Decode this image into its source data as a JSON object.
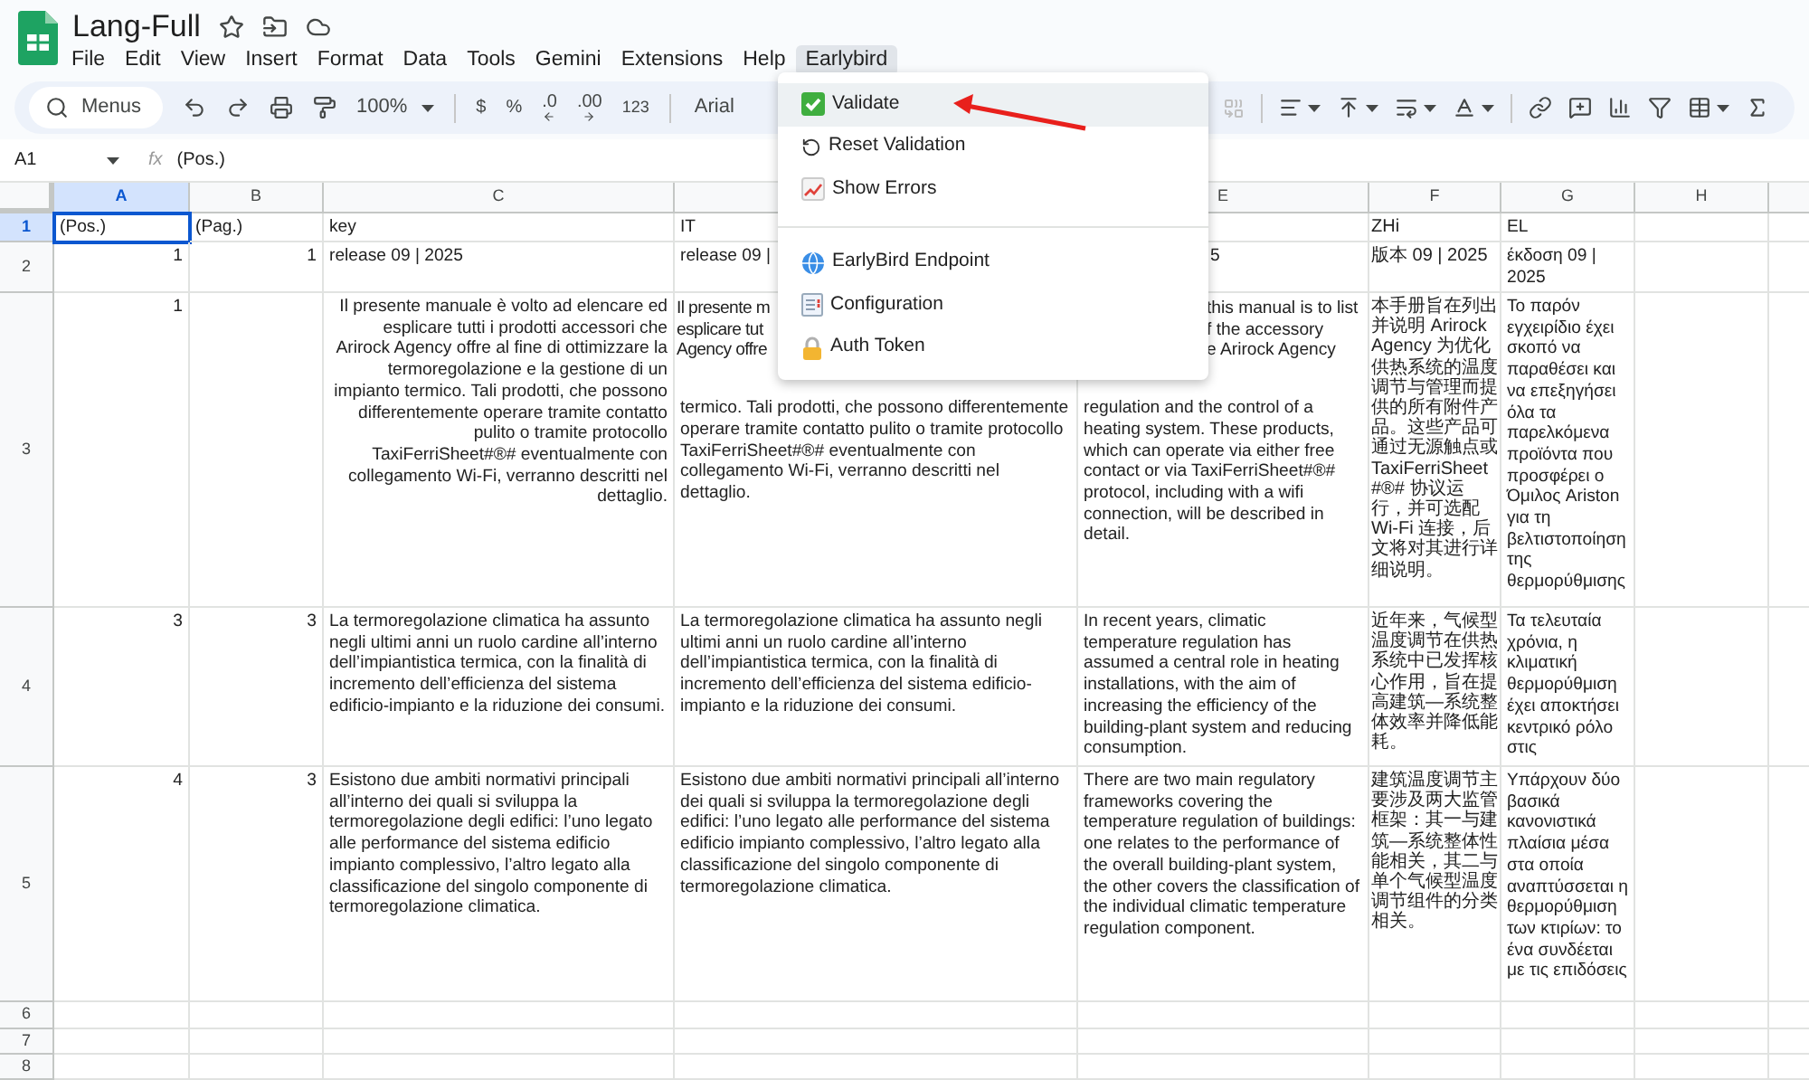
{
  "document": {
    "title": "Lang-Full"
  },
  "menubar": [
    {
      "label": "File",
      "selected": false
    },
    {
      "label": "Edit",
      "selected": false
    },
    {
      "label": "View",
      "selected": false
    },
    {
      "label": "Insert",
      "selected": false
    },
    {
      "label": "Format",
      "selected": false
    },
    {
      "label": "Data",
      "selected": false
    },
    {
      "label": "Tools",
      "selected": false
    },
    {
      "label": "Gemini",
      "selected": false
    },
    {
      "label": "Extensions",
      "selected": false
    },
    {
      "label": "Help",
      "selected": false
    },
    {
      "label": "Earlybird",
      "selected": true
    }
  ],
  "toolbar": {
    "search": "Menus",
    "zoom": "100%",
    "currency": "$",
    "percent": "%",
    "decimal_decrease": ".0",
    "decimal_increase": ".00",
    "number_format": "123",
    "font": "Arial"
  },
  "formula_bar": {
    "cell_ref": "A1",
    "fx": "fx",
    "value": "(Pos.)"
  },
  "dropdown": {
    "groups": [
      [
        {
          "kind": "check",
          "label": "Validate",
          "selected": true
        },
        {
          "kind": "reset",
          "label": "Reset Validation",
          "selected": false
        },
        {
          "kind": "chart",
          "label": "Show Errors",
          "selected": false
        }
      ],
      [
        {
          "kind": "globe",
          "label": "EarlyBird Endpoint",
          "selected": false
        },
        {
          "kind": "config",
          "label": "Configuration",
          "selected": false
        },
        {
          "kind": "lock",
          "label": "Auth Token",
          "selected": false
        }
      ]
    ]
  },
  "columns": [
    {
      "label": "A",
      "selected": true
    },
    {
      "label": "B",
      "selected": false
    },
    {
      "label": "C",
      "selected": false
    },
    {
      "selected": false
    },
    {
      "label": "E",
      "selected": false
    },
    {
      "label": "F",
      "selected": false
    },
    {
      "label": "G",
      "selected": false
    },
    {
      "label": "H",
      "selected": false
    }
  ],
  "rows": [
    {
      "label": "1",
      "selected": true,
      "cells": [
        {
          "kind": "text",
          "text": "(Pos.)",
          "selected": true
        },
        {
          "kind": "text",
          "text": "(Pag.)",
          "selected": false
        },
        {
          "kind": "text",
          "text": "key",
          "selected": false
        },
        {
          "kind": "text",
          "text": "IT",
          "selected": false
        },
        {
          "kind": "empty",
          "selected": false
        },
        {
          "kind": "text",
          "text": "ZHi",
          "selected": false
        },
        {
          "kind": "text",
          "text": "EL",
          "selected": false
        },
        {
          "kind": "empty",
          "selected": false
        }
      ]
    },
    {
      "label": "2",
      "selected": false,
      "cells": [
        {
          "kind": "number",
          "text": "1",
          "selected": false
        },
        {
          "kind": "number",
          "text": "1",
          "selected": false
        },
        {
          "kind": "text",
          "text": "release 09 | 2025",
          "selected": false
        },
        {
          "kind": "text",
          "text": "release 09 |",
          "selected": false
        },
        {
          "kind": "clipped",
          "text": "5",
          "selected": false
        },
        {
          "kind": "text",
          "text": "版本 09 | 2025",
          "selected": false
        },
        {
          "kind": "text",
          "text": "έκδοση 09 | 2025",
          "selected": false
        },
        {
          "kind": "empty",
          "selected": false
        }
      ]
    },
    {
      "label": "3",
      "selected": false,
      "cells": [
        {
          "kind": "number",
          "text": "1",
          "selected": false
        },
        {
          "kind": "empty",
          "selected": false
        },
        {
          "kind": "right",
          "text": "Il presente manuale è volto ad elencare ed esplicare tutti i prodotti accessori che Arirock Agency offre al fine di ottimizzare la termoregolazione e la gestione di un impianto termico. Tali prodotti, che possono differentemente operare tramite contatto pulito o tramite protocollo TaxiFerriSheet#®# eventualmente con collegamento Wi-Fi, verranno descritti nel dettaglio.",
          "selected": false
        },
        {
          "kind": "covered_left",
          "fragments": [
            "Il presente m",
            "esplicare tut",
            "Agency offre"
          ],
          "text": "termico. Tali prodotti, che possono differentemente operare tramite contatto pulito o tramite protocollo TaxiFerriSheet#®# eventualmente con collegamento Wi-Fi, verranno descritti nel dettaglio.",
          "selected": false
        },
        {
          "kind": "covered_right",
          "fragments": [
            "this manual is to list",
            "f the accessory",
            "e Arirock Agency"
          ],
          "text": "regulation and the control of a heating system. These products, which can operate via either free contact or via TaxiFerriSheet#®# protocol, including with a wifi connection, will be described in detail.",
          "selected": false
        },
        {
          "kind": "text",
          "text": "本手册旨在列出并说明 Arirock Agency 为优化供热系统的温度调节与管理而提供的所有附件产品。这些产品可通过无源触点或 TaxiFerriSheet#®# 协议运行，并可选配 Wi-Fi 连接，后文将对其进行详细说明。",
          "selected": false
        },
        {
          "kind": "text",
          "text": "Το παρόν εγχειρίδιο έχει σκοπό να παραθέσει και να επεξηγήσει όλα τα παρελκόμενα προϊόντα που προσφέρει ο Όμιλος Ariston για τη βελτιστοποίηση της θερμορύθμισης",
          "selected": false
        },
        {
          "kind": "empty",
          "selected": false
        }
      ]
    },
    {
      "label": "4",
      "selected": false,
      "cells": [
        {
          "kind": "number",
          "text": "3",
          "selected": false
        },
        {
          "kind": "number",
          "text": "3",
          "selected": false
        },
        {
          "kind": "text",
          "text": "La termoregolazione climatica ha assunto negli ultimi anni un ruolo cardine all’interno dell’impiantistica termica, con la finalità di incremento dell’efficienza del sistema edificio-impianto e la riduzione dei consumi.",
          "selected": false
        },
        {
          "kind": "text",
          "text": "La termoregolazione climatica ha assunto negli ultimi anni un ruolo cardine all’interno dell’impiantistica termica, con la finalità di incremento dell’efficienza del sistema edificio-impianto e la riduzione dei consumi.",
          "selected": false
        },
        {
          "kind": "text",
          "text": "In recent years, climatic temperature regulation has assumed a central role in heating installations, with the aim of increasing the efficiency of the building-plant system and reducing consumption.",
          "selected": false
        },
        {
          "kind": "text",
          "text": "近年来，气候型温度调节在供热系统中已发挥核心作用，旨在提高建筑—系统整体效率并降低能耗。",
          "selected": false
        },
        {
          "kind": "text",
          "text": "Τα τελευταία χρόνια, η κλιματική θερμορύθμιση έχει αποκτήσει κεντρικό ρόλο στις",
          "selected": false
        },
        {
          "kind": "empty",
          "selected": false
        }
      ]
    },
    {
      "label": "5",
      "selected": false,
      "cells": [
        {
          "kind": "number",
          "text": "4",
          "selected": false
        },
        {
          "kind": "number",
          "text": "3",
          "selected": false
        },
        {
          "kind": "text",
          "text": "Esistono due ambiti normativi principali all’interno dei quali si sviluppa la termoregolazione degli edifici: l’uno legato alle performance del sistema edificio impianto complessivo, l’altro legato alla classificazione del singolo componente di termoregolazione climatica.",
          "selected": false
        },
        {
          "kind": "text",
          "text": "Esistono due ambiti normativi principali all’interno dei quali si sviluppa la termoregolazione degli edifici: l’uno legato alle performance del sistema edificio impianto complessivo, l’altro legato alla classificazione del singolo componente di termoregolazione climatica.",
          "selected": false
        },
        {
          "kind": "text",
          "text": "There are two main regulatory frameworks covering the temperature regulation of buildings: one relates to the performance of the overall building-plant system, the other covers the classification of the individual climatic temperature regulation component.",
          "selected": false
        },
        {
          "kind": "text",
          "text": "建筑温度调节主要涉及两大监管框架：其一与建筑—系统整体性能相关，其二与单个气候型温度调节组件的分类相关。",
          "selected": false
        },
        {
          "kind": "text",
          "text": "Υπάρχουν δύο βασικά κανονιστικά πλαίσια μέσα στα οποία αναπτύσσεται η θερμορύθμιση των κτιρίων: το ένα συνδέεται με τις επιδόσεις",
          "selected": false
        },
        {
          "kind": "empty",
          "selected": false
        }
      ]
    },
    {
      "label": "6",
      "selected": false,
      "cells": []
    },
    {
      "label": "7",
      "selected": false,
      "cells": []
    },
    {
      "label": "8",
      "selected": false,
      "cells": []
    }
  ]
}
